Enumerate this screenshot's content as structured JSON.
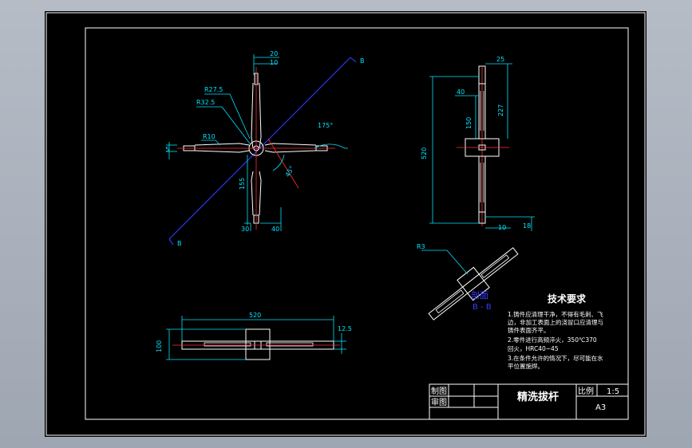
{
  "drawing": {
    "dims_cross": {
      "d20": "20",
      "d10": "10",
      "r275": "R27.5",
      "r325": "R32.5",
      "r10": "R10",
      "d5": "5",
      "d155": "155",
      "d30": "30",
      "d40": "40",
      "a175": "175°",
      "a45": "45°",
      "sec_b": "B"
    },
    "dims_side": {
      "d25": "25",
      "d40": "40",
      "d227": "227",
      "d150": "150",
      "d520": "520",
      "d10": "10",
      "d18": "18"
    },
    "dims_bottom": {
      "d520": "520",
      "d125": "12.5",
      "d100": "100"
    },
    "dims_iso": {
      "r3": "R3"
    },
    "section_label": {
      "line1": "剖面",
      "line2": "B - B"
    },
    "tech": {
      "title": "技术要求",
      "lines": [
        "1.铸件应清理干净，不得有毛刺、飞",
        "边，非加工表面上的浇冒口应清理与",
        "铸件表面齐平。",
        "2.零件进行高频淬火，350℃370",
        "回火，HRC40~45",
        "3.在条件允许的情况下，尽可能在水",
        "平位置施焊。"
      ]
    },
    "title_block": {
      "draw": "制图",
      "check": "审图",
      "name": "精洗拔杆",
      "scale_label": "比例",
      "scale_value": "1:5",
      "sheet": "A3"
    }
  },
  "colors": {
    "line": "#ffffff",
    "dim": "#00e5ff",
    "center": "#ff3030",
    "section": "#2f3dff",
    "paper": "#000000"
  }
}
